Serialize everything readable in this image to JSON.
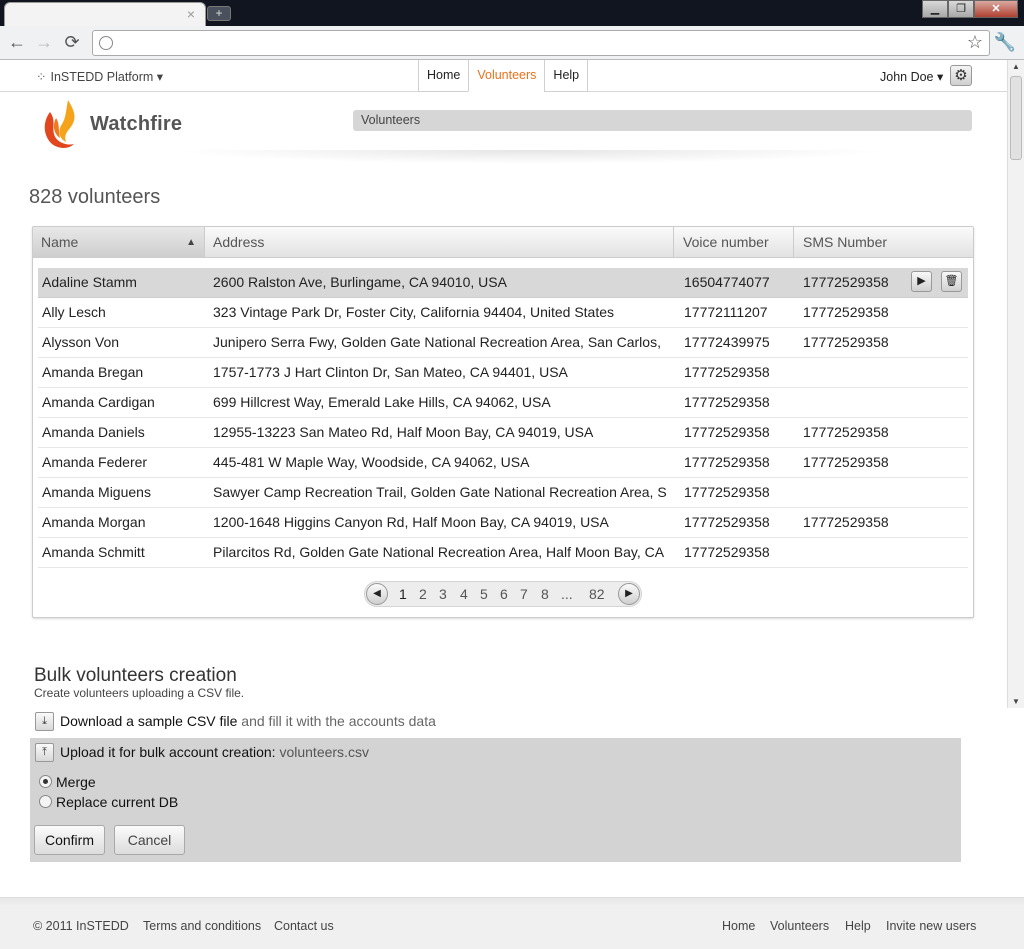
{
  "browser": {
    "tab_close": "×",
    "newtab": "+",
    "win_min": "▁",
    "win_max": "❐",
    "win_close": "✕",
    "back": "←",
    "forward": "→",
    "reload": "⟳",
    "star": "☆",
    "wrench": "🔧",
    "url": ""
  },
  "header": {
    "platform": "InSTEDD Platform",
    "nav": [
      "Home",
      "Volunteers",
      "Help"
    ],
    "active_nav": "Volunteers",
    "user": "John Doe",
    "logo_text": "Watchfire",
    "breadcrumb": "Volunteers"
  },
  "main": {
    "count_title": "828 volunteers",
    "columns": [
      "Name",
      "Address",
      "Voice number",
      "SMS Number"
    ],
    "rows": [
      {
        "name": "Adaline Stamm",
        "address": "2600 Ralston Ave, Burlingame, CA 94010, USA",
        "voice": "16504774077",
        "sms": "17772529358"
      },
      {
        "name": "Ally Lesch",
        "address": "323 Vintage Park Dr, Foster City, California 94404, United States",
        "voice": "17772111207",
        "sms": "17772529358"
      },
      {
        "name": "Alysson Von",
        "address": "Junipero Serra Fwy, Golden Gate National Recreation Area, San Carlos,",
        "voice": "17772439975",
        "sms": "17772529358"
      },
      {
        "name": "Amanda Bregan",
        "address": "1757-1773 J Hart Clinton Dr, San Mateo, CA 94401, USA",
        "voice": "17772529358",
        "sms": ""
      },
      {
        "name": "Amanda Cardigan",
        "address": "699 Hillcrest Way, Emerald Lake Hills, CA 94062, USA",
        "voice": "17772529358",
        "sms": ""
      },
      {
        "name": "Amanda Daniels",
        "address": "12955-13223 San Mateo Rd, Half Moon Bay, CA 94019, USA",
        "voice": "17772529358",
        "sms": "17772529358"
      },
      {
        "name": "Amanda Federer",
        "address": "445-481 W Maple Way, Woodside, CA 94062, USA",
        "voice": "17772529358",
        "sms": "17772529358"
      },
      {
        "name": "Amanda Miguens",
        "address": "Sawyer Camp Recreation Trail, Golden Gate National Recreation Area, S",
        "voice": "17772529358",
        "sms": ""
      },
      {
        "name": "Amanda Morgan",
        "address": "1200-1648 Higgins Canyon Rd, Half Moon Bay, CA 94019, USA",
        "voice": "17772529358",
        "sms": "17772529358"
      },
      {
        "name": "Amanda Schmitt",
        "address": "Pilarcitos Rd, Golden Gate National Recreation Area, Half Moon Bay, CA",
        "voice": "17772529358",
        "sms": ""
      }
    ],
    "pager": {
      "prev": "◀",
      "next": "▶",
      "pages": [
        "1",
        "2",
        "3",
        "4",
        "5",
        "6",
        "7",
        "8",
        "...",
        "82"
      ],
      "current": "1"
    }
  },
  "bulk": {
    "title": "Bulk volunteers creation",
    "subtitle": "Create volunteers uploading a CSV file.",
    "download_link": "Download a sample CSV file",
    "download_rest": " and fill it with the accounts data",
    "upload_label": "Upload it for bulk account creation:",
    "upload_file": " volunteers.csv",
    "options": [
      "Merge",
      "Replace current DB"
    ],
    "selected_option": "Merge",
    "confirm": "Confirm",
    "cancel": "Cancel"
  },
  "footer": {
    "copyright": "© 2011 InSTEDD",
    "terms": "Terms and conditions",
    "contact": "Contact us",
    "links": [
      "Home",
      "Volunteers",
      "Help",
      "Invite new users"
    ]
  },
  "icons": {
    "edit_row": "▶",
    "delete_row": "🗑",
    "download": "⤓",
    "upload": "⤒",
    "gear": "⚙",
    "sort": "▲"
  }
}
